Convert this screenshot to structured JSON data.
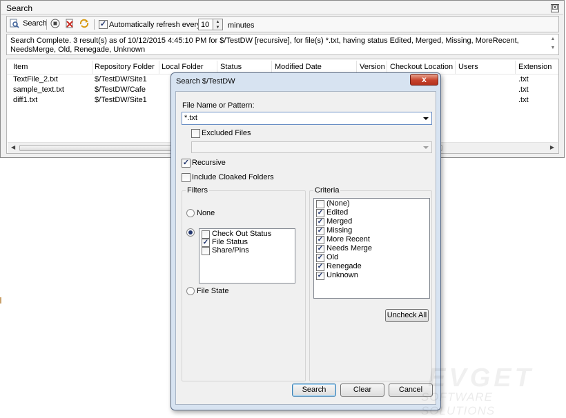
{
  "panel": {
    "title": "Search",
    "close_glyph": "☒",
    "toolbar": {
      "search_label": "Search",
      "auto_refresh_checked": true,
      "auto_refresh_label": "Automatically refresh every",
      "refresh_value": "10",
      "minutes_label": "minutes"
    },
    "status_text": "Search Complete. 3 result(s) as of 10/12/2015 4:45:10 PM for $/TestDW [recursive], for file(s) *.txt, having status Edited, Merged, Missing, MoreRecent, NeedsMerge, Old, Renegade, Unknown",
    "columns": [
      "Item",
      "Repository Folder",
      "Local Folder",
      "Status",
      "Modified Date",
      "Version",
      "Checkout Location",
      "Users",
      "Extension"
    ],
    "rows": [
      {
        "item": "TextFile_2.txt",
        "repo": "$/TestDW/Site1",
        "ext": ".txt"
      },
      {
        "item": "sample_text.txt",
        "repo": "$/TestDW/Cafe",
        "ext": ".txt"
      },
      {
        "item": "diff1.txt",
        "repo": "$/TestDW/Site1",
        "ext": ".txt"
      }
    ]
  },
  "dialog": {
    "title": "Search $/TestDW",
    "close_glyph": "x",
    "pattern_label": "File Name or Pattern:",
    "pattern_value": "*.txt",
    "excluded_label": "Excluded Files",
    "excluded_checked": false,
    "recursive_label": "Recursive",
    "recursive_checked": true,
    "cloaked_label": "Include Cloaked Folders",
    "cloaked_checked": false,
    "filters": {
      "group_label": "Filters",
      "none_label": "None",
      "items": [
        {
          "label": "Check Out Status",
          "checked": false
        },
        {
          "label": "File Status",
          "checked": true
        },
        {
          "label": "Share/Pins",
          "checked": false
        }
      ],
      "file_state_label": "File State",
      "selected": "list"
    },
    "criteria": {
      "group_label": "Criteria",
      "items": [
        {
          "label": "(None)",
          "checked": false
        },
        {
          "label": "Edited",
          "checked": true
        },
        {
          "label": "Merged",
          "checked": true
        },
        {
          "label": "Missing",
          "checked": true
        },
        {
          "label": "More Recent",
          "checked": true
        },
        {
          "label": "Needs Merge",
          "checked": true
        },
        {
          "label": "Old",
          "checked": true
        },
        {
          "label": "Renegade",
          "checked": true
        },
        {
          "label": "Unknown",
          "checked": true
        }
      ],
      "uncheck_all_label": "Uncheck All"
    },
    "buttons": {
      "search": "Search",
      "clear": "Clear",
      "cancel": "Cancel"
    }
  },
  "watermark": {
    "line1": "EVGET",
    "line2": "SOFTWARE SOLUTIONS"
  },
  "colors": {
    "title_bar": "#d7e3f1",
    "close_red": "#c7432c",
    "check_mark": "#21356e"
  }
}
